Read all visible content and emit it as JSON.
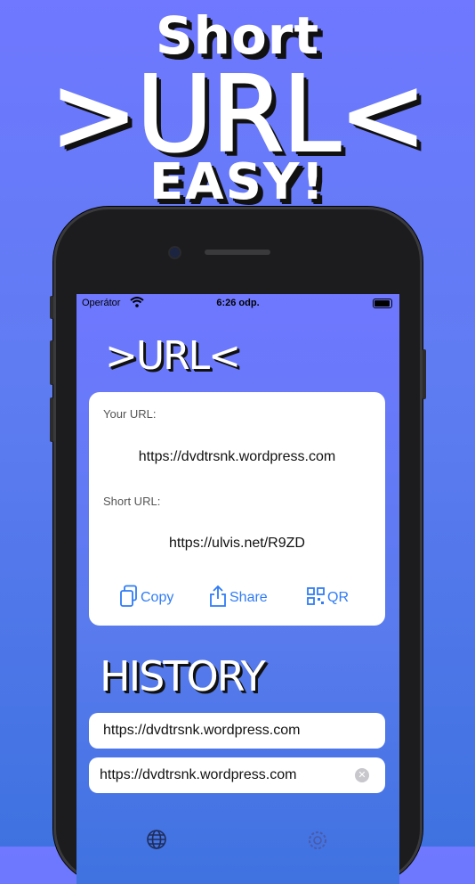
{
  "promo": {
    "line1": "Short",
    "line2": ">URL<",
    "line3": "EASY!"
  },
  "status_bar": {
    "carrier": "Operátor",
    "time": "6:26 odp."
  },
  "app": {
    "logo": ">URL<"
  },
  "url_card": {
    "your_url_label": "Your URL:",
    "your_url_value": "https://dvdtrsnk.wordpress.com",
    "short_url_label": "Short URL:",
    "short_url_value": "https://ulvis.net/R9ZD",
    "actions": [
      {
        "label": "Copy",
        "icon": "copy-icon"
      },
      {
        "label": "Share",
        "icon": "share-icon"
      },
      {
        "label": "QR",
        "icon": "qr-code-icon"
      }
    ]
  },
  "history": {
    "title": "HISTORY",
    "items": [
      {
        "url": "https://dvdtrsnk.wordpress.com"
      },
      {
        "url": "https://dvdtrsnk.wordpress.com"
      }
    ]
  },
  "tab_bar": {
    "icons": [
      "globe-icon",
      "gear-icon"
    ]
  },
  "colors": {
    "accent": "#2f7cf6",
    "background_top": "#6f78ff",
    "background_bottom": "#3f72e0"
  }
}
